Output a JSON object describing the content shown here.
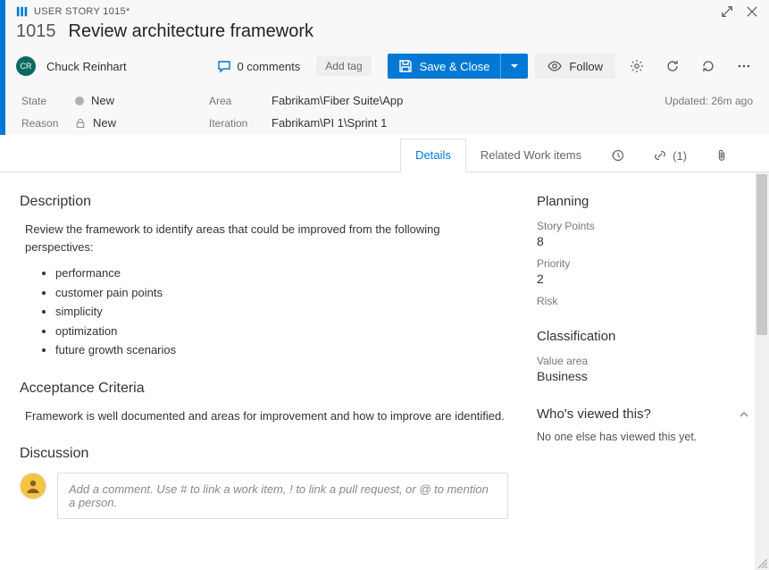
{
  "type_label": "USER STORY 1015*",
  "work_id": "1015",
  "work_title": "Review architecture framework",
  "assignee": {
    "initials": "CR",
    "name": "Chuck Reinhart"
  },
  "comments_count": "0 comments",
  "add_tag": "Add tag",
  "save_label": "Save & Close",
  "follow_label": "Follow",
  "meta": {
    "state_label": "State",
    "state_value": "New",
    "reason_label": "Reason",
    "reason_value": "New",
    "area_label": "Area",
    "area_value": "Fabrikam\\Fiber Suite\\App",
    "iteration_label": "Iteration",
    "iteration_value": "Fabrikam\\PI 1\\Sprint 1",
    "updated": "Updated: 26m ago"
  },
  "tabs": {
    "details": "Details",
    "related": "Related Work items",
    "links_count": "(1)"
  },
  "description": {
    "heading": "Description",
    "intro": "Review the framework to identify areas that could be improved from the following perspectives:",
    "bullets": [
      "performance",
      "customer pain points",
      "simplicity",
      "optimization",
      "future growth scenarios"
    ]
  },
  "acceptance": {
    "heading": "Acceptance Criteria",
    "text": "Framework is well documented and areas for improvement and how to improve are identified."
  },
  "discussion": {
    "heading": "Discussion",
    "placeholder": "Add a comment. Use # to link a work item, ! to link a pull request, or @ to mention a person."
  },
  "planning": {
    "heading": "Planning",
    "story_points_label": "Story Points",
    "story_points_value": "8",
    "priority_label": "Priority",
    "priority_value": "2",
    "risk_label": "Risk"
  },
  "classification": {
    "heading": "Classification",
    "value_area_label": "Value area",
    "value_area_value": "Business"
  },
  "viewed": {
    "heading": "Who's viewed this?",
    "text": "No one else has viewed this yet."
  }
}
